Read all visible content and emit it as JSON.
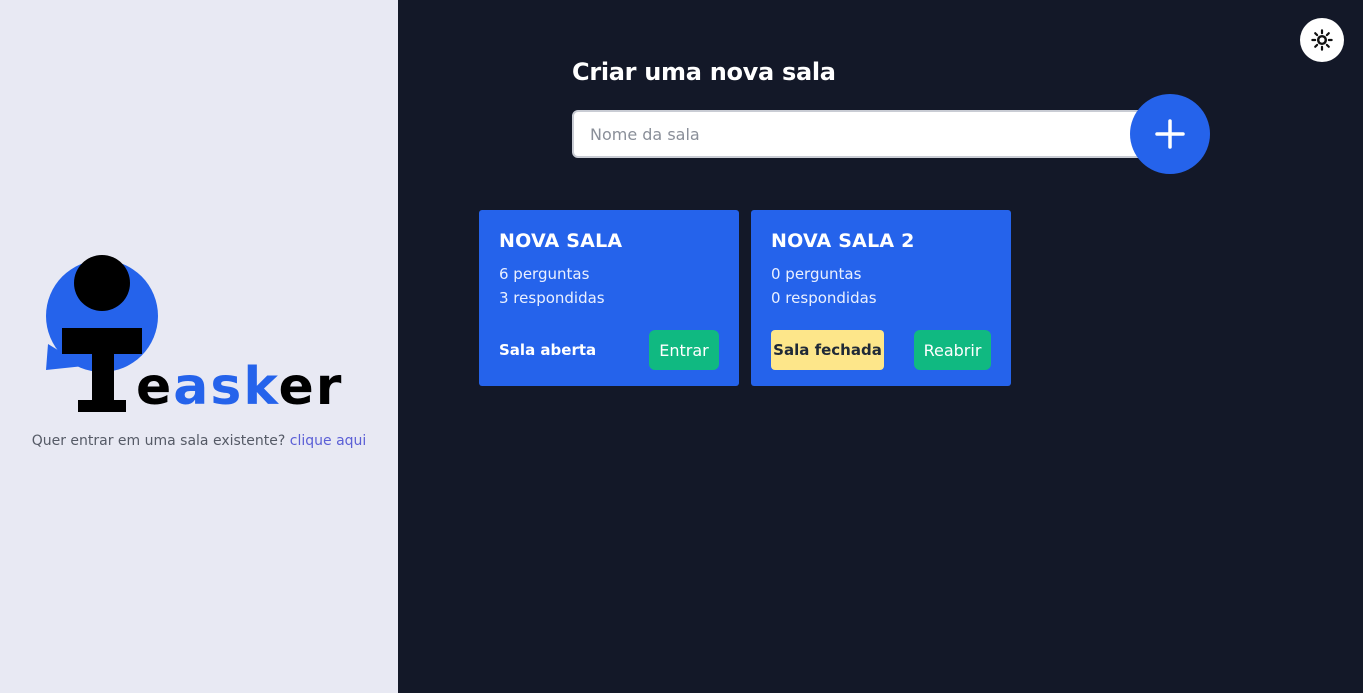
{
  "brand": {
    "logo_text": "easker",
    "accent": "#2563eb"
  },
  "join": {
    "prompt": "Quer entrar em uma sala existente?",
    "link": "clique aqui"
  },
  "header": {
    "theme_toggle_icon": "sun-icon"
  },
  "create": {
    "title": "Criar uma nova sala",
    "placeholder": "Nome da sala",
    "add_icon": "plus-icon"
  },
  "rooms": [
    {
      "name": "NOVA SALA",
      "questions": "6 perguntas",
      "answered": "3 respondidas",
      "status": "Sala aberta",
      "action": "Entrar"
    },
    {
      "name": "NOVA SALA 2",
      "questions": "0 perguntas",
      "answered": "0 respondidas",
      "status": "Sala fechada",
      "action": "Reabrir"
    }
  ],
  "colors": {
    "card": "#2563eb",
    "button": "#10b981",
    "closed_badge": "#fde68a",
    "background": "#131828",
    "sidebar": "#e8e9f3"
  }
}
